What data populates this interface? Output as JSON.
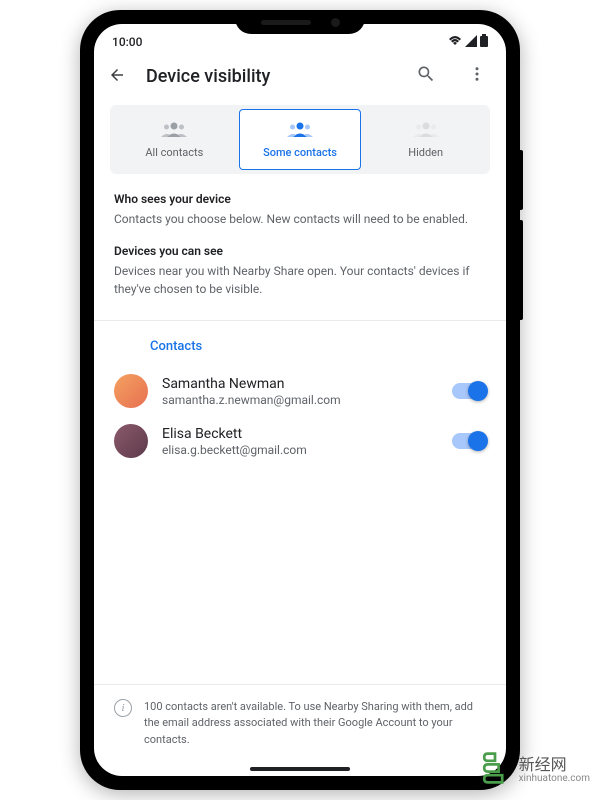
{
  "status": {
    "time": "10:00"
  },
  "header": {
    "title": "Device visibility"
  },
  "tabs": {
    "all": "All contacts",
    "some": "Some contacts",
    "hidden": "Hidden"
  },
  "sections": {
    "who_sees_title": "Who sees your device",
    "who_sees_desc": "Contacts you choose below. New contacts will need to be enabled.",
    "devices_title": "Devices you can see",
    "devices_desc": "Devices near you with Nearby Share open. Your contacts' devices if they've chosen to be visible."
  },
  "contacts": {
    "header": "Contacts",
    "list": [
      {
        "name": "Samantha Newman",
        "email": "samantha.z.newman@gmail.com"
      },
      {
        "name": "Elisa Beckett",
        "email": "elisa.g.beckett@gmail.com"
      }
    ]
  },
  "footer": {
    "notice": "100 contacts aren't available. To use Nearby Sharing with them, add the email address associated with their Google Account to your contacts."
  },
  "watermark": {
    "cn": "新经网",
    "url": "xinhuatone.com"
  }
}
